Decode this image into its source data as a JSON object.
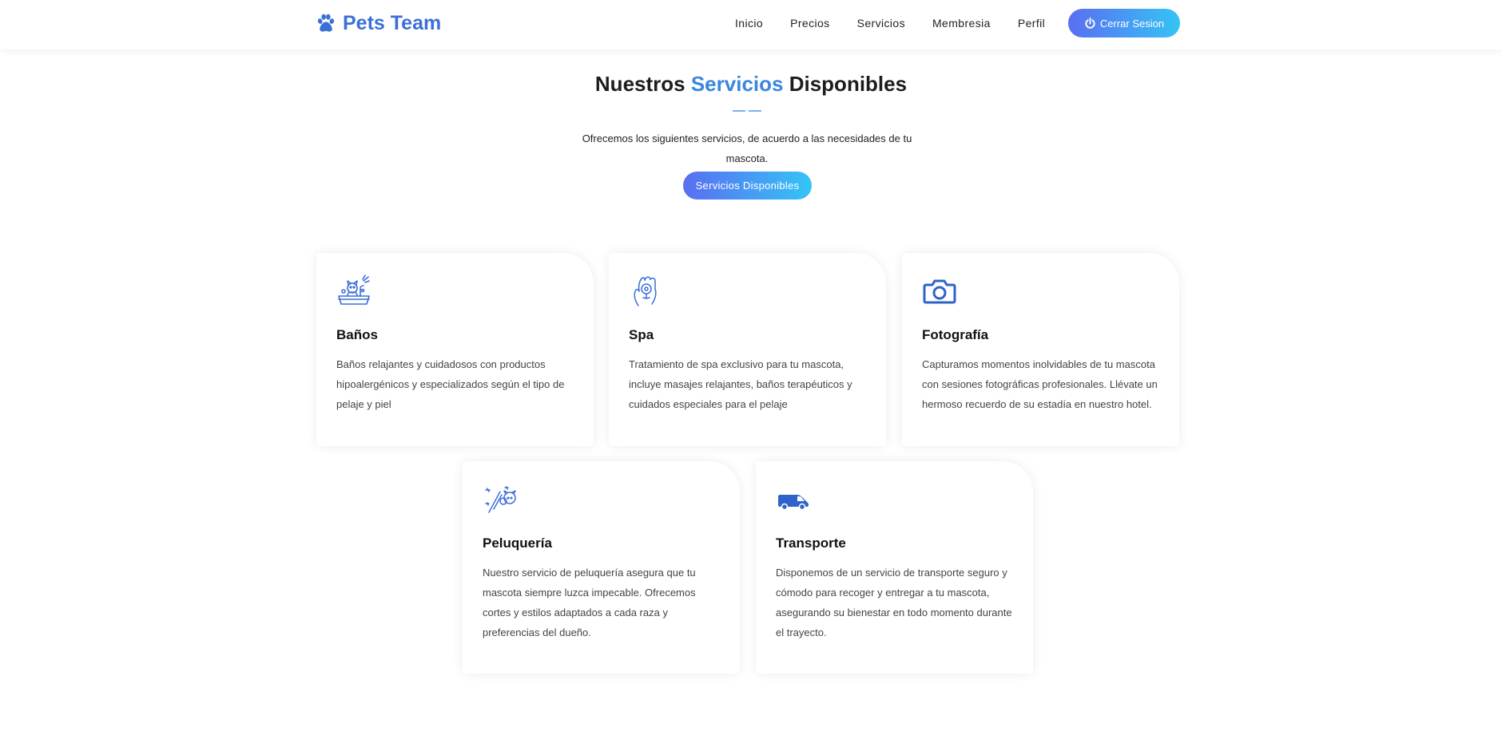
{
  "header": {
    "brand": "Pets Team",
    "nav": [
      "Inicio",
      "Precios",
      "Servicios",
      "Membresia",
      "Perfil"
    ],
    "logout_label": "Cerrar Sesion"
  },
  "hero": {
    "title_part1": "Nuestros",
    "title_accent": "Servicios",
    "title_part2": "Disponibles",
    "subtitle": "Ofrecemos los siguientes servicios, de acuerdo a las necesidades de tu mascota.",
    "button_label": "Servicios Disponibles"
  },
  "cards": [
    {
      "icon": "pet-bath-icon",
      "title": "Baños",
      "text": "Baños relajantes y cuidadosos con productos hipoalergénicos y especializados según el tipo de pelaje y piel"
    },
    {
      "icon": "spa-hand-icon",
      "title": "Spa",
      "text": "Tratamiento de spa exclusivo para tu mascota, incluye masajes relajantes, baños terapéuticos y cuidados especiales para el pelaje"
    },
    {
      "icon": "camera-icon",
      "title": "Fotografía",
      "text": "Capturamos momentos inolvidables de tu mascota con sesiones fotográficas profesionales. Llévate un hermoso recuerdo de su estadía en nuestro hotel."
    },
    {
      "icon": "grooming-icon",
      "title": "Peluquería",
      "text": "Nuestro servicio de peluquería asegura que tu mascota siempre luzca impecable. Ofrecemos cortes y estilos adaptados a cada raza y preferencias del dueño."
    },
    {
      "icon": "van-icon",
      "title": "Transporte",
      "text": "Disponemos de un servicio de transporte seguro y cómodo para recoger y entregar a tu mascota, asegurando su bienestar en todo momento durante el trayecto."
    }
  ],
  "colors": {
    "brand": "#3a6fd8",
    "accent": "#3a86e0",
    "gradient_start": "#5a6ef2",
    "gradient_end": "#35c4f5"
  }
}
